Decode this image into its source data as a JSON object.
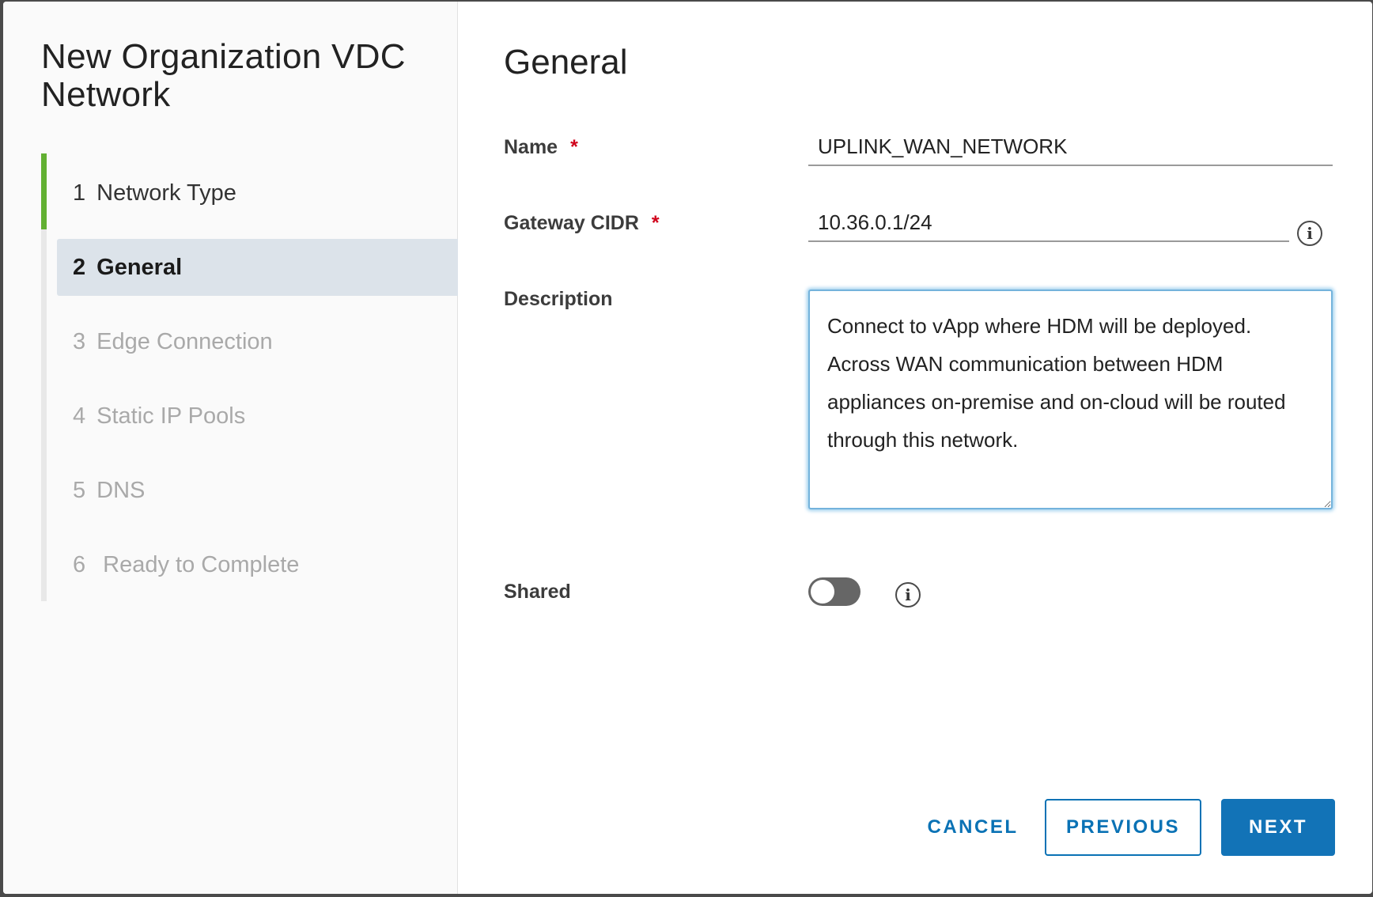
{
  "dialog": {
    "title": "New Organization VDC Network"
  },
  "steps": [
    {
      "number": "1",
      "label": "Network Type",
      "state": "done"
    },
    {
      "number": "2",
      "label": "General",
      "state": "active"
    },
    {
      "number": "3",
      "label": "Edge Connection",
      "state": "pending"
    },
    {
      "number": "4",
      "label": "Static IP Pools",
      "state": "pending"
    },
    {
      "number": "5",
      "label": "DNS",
      "state": "pending"
    },
    {
      "number": "6",
      "label": "Ready to Complete",
      "state": "pending"
    }
  ],
  "form": {
    "section_title": "General",
    "name": {
      "label": "Name",
      "required": "*",
      "value": "UPLINK_WAN_NETWORK"
    },
    "gateway_cidr": {
      "label": "Gateway CIDR",
      "required": "*",
      "value": "10.36.0.1/24"
    },
    "description": {
      "label": "Description",
      "value": "Connect to vApp where HDM will be deployed. Across WAN communication between HDM appliances on-premise and on-cloud will be routed through this network."
    },
    "shared": {
      "label": "Shared",
      "enabled": false
    }
  },
  "footer": {
    "cancel_label": "CANCEL",
    "previous_label": "PREVIOUS",
    "next_label": "NEXT"
  },
  "colors": {
    "primary": "#1273b7",
    "step_done": "#62b032",
    "active_step_bg": "#dce3ea",
    "required": "#d0021b",
    "focus_border": "#74b3dc"
  },
  "icons": {
    "info": "info-circle-icon",
    "resize": "resize-handle-icon"
  }
}
